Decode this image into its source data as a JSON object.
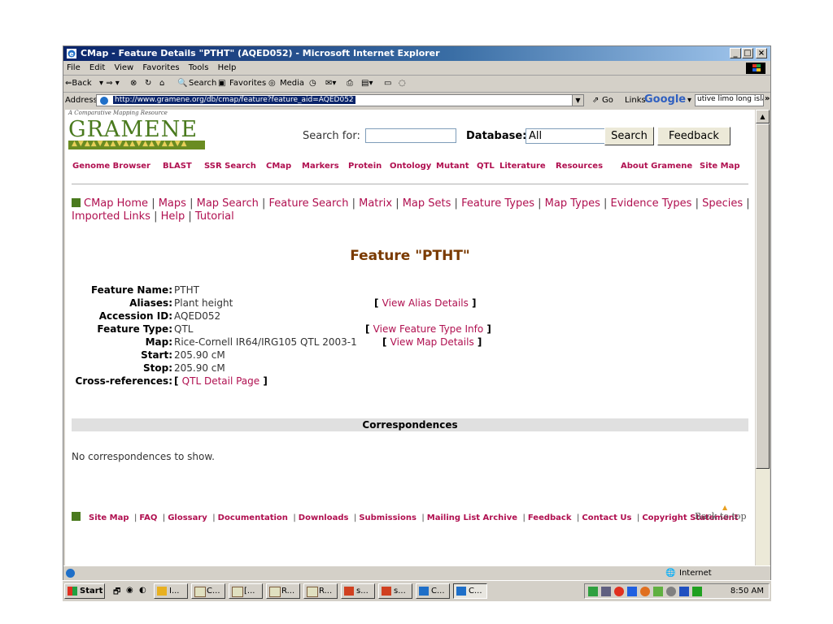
{
  "window": {
    "title": "CMap - Feature Details \"PTHT\" (AQED052) - Microsoft Internet Explorer",
    "controls": [
      "_",
      "□",
      "×"
    ]
  },
  "menu": [
    "File",
    "Edit",
    "View",
    "Favorites",
    "Tools",
    "Help"
  ],
  "toolbar": {
    "back": "⇐Back",
    "search": "Search",
    "favorites": "Favorites",
    "media": "Media"
  },
  "address": {
    "label": "Address",
    "url": "http://www.gramene.org/db/cmap/feature?feature_aid=AQED052",
    "go": "Go",
    "links": "Links",
    "google": "Google",
    "google_field": "utive limo long islar"
  },
  "site": {
    "tagline": "A Comparative Mapping Resource",
    "logo": "GRAMENE",
    "search_label": "Search for:",
    "search_value": "",
    "database_label": "Database:",
    "database_value": "All",
    "search_button": "Search",
    "feedback_button": "Feedback",
    "top_nav": [
      "Genome Browser",
      "BLAST",
      "SSR Search",
      "CMap",
      "Markers",
      "Protein",
      "Ontology",
      "Mutant",
      "QTL",
      "Literature",
      "Resources",
      "About Gramene",
      "Site Map"
    ]
  },
  "cmap_nav": [
    "CMap Home",
    "Maps",
    "Map Search",
    "Feature Search",
    "Matrix",
    "Map Sets",
    "Feature Types",
    "Map Types",
    "Evidence Types",
    "Species",
    "Imported Links",
    "Help",
    "Tutorial"
  ],
  "feature": {
    "title": "Feature \"PTHT\"",
    "details": [
      {
        "key": "Feature Name:",
        "value": "PTHT",
        "link": ""
      },
      {
        "key": "Aliases:",
        "value": "Plant height",
        "link": "View Alias Details"
      },
      {
        "key": "Accession ID:",
        "value": "AQED052",
        "link": ""
      },
      {
        "key": "Feature Type:",
        "value": "QTL",
        "link": "View Feature Type Info"
      },
      {
        "key": "Map:",
        "value": "Rice-Cornell IR64/IRG105 QTL 2003-1",
        "link": "View Map Details"
      },
      {
        "key": "Start:",
        "value": "205.90 cM",
        "link": ""
      },
      {
        "key": "Stop:",
        "value": "205.90 cM",
        "link": ""
      },
      {
        "key": "Cross-references:",
        "value": "",
        "link": "QTL Detail Page"
      }
    ]
  },
  "correspondences": {
    "header": "Correspondences",
    "empty": "No correspondences to show."
  },
  "footer": {
    "links": [
      "Site Map",
      "FAQ",
      "Glossary",
      "Documentation",
      "Downloads",
      "Submissions",
      "Mailing List Archive",
      "Feedback",
      "Contact Us",
      "Copyright Statement"
    ],
    "back_to_top": "Back to top"
  },
  "status": {
    "zone": "Internet"
  },
  "taskbar": {
    "start": "Start",
    "items": [
      "I...",
      "C...",
      "[...",
      "R...",
      "R...",
      "s...",
      "s...",
      "C...",
      "C..."
    ],
    "clock": "8:50 AM"
  }
}
